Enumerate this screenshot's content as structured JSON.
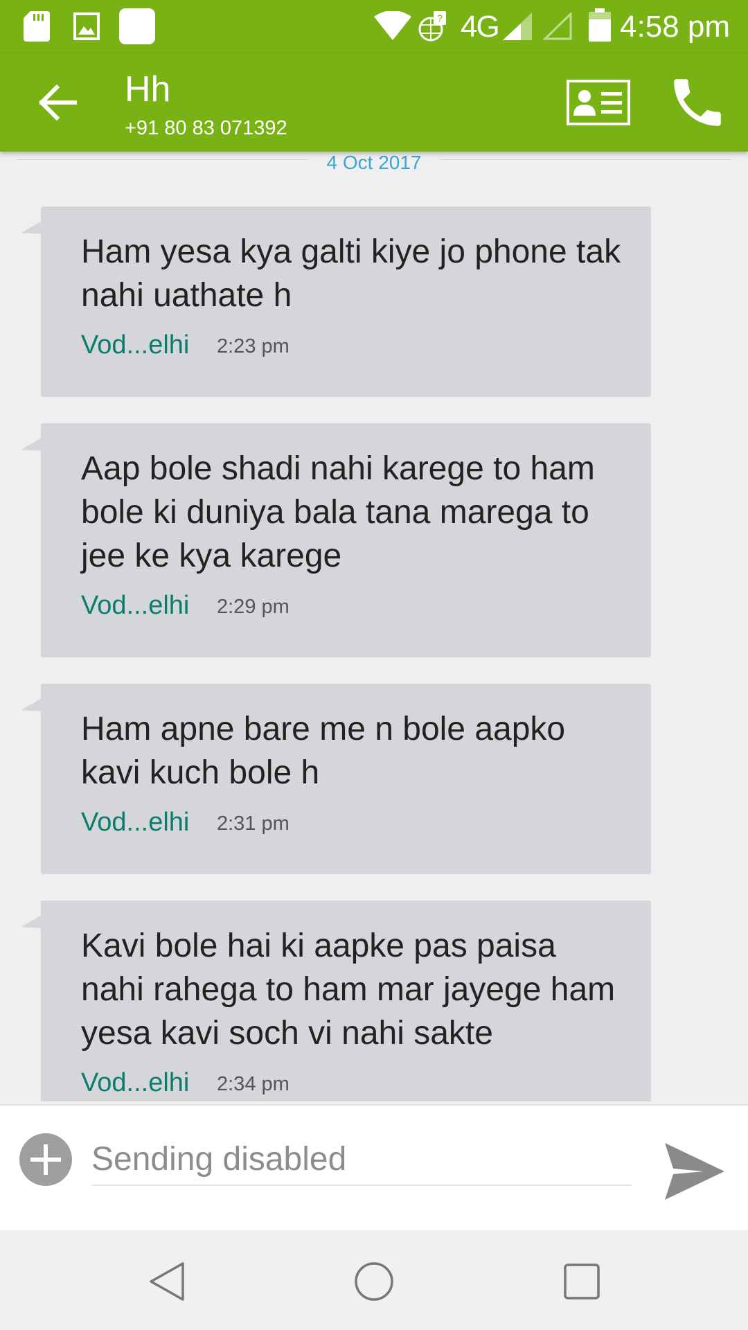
{
  "status_bar": {
    "time": "4:58 pm",
    "network": "4G",
    "icons": [
      "sd-card-icon",
      "gallery-icon",
      "notification-square-icon",
      "wifi-icon",
      "data-transfer-icon",
      "signal-icon",
      "signal-empty-icon",
      "battery-icon"
    ]
  },
  "app_bar": {
    "contact_name": "Hh",
    "contact_number": "+91 80 83 071392",
    "icons": [
      "back-arrow-icon",
      "contact-card-icon",
      "phone-icon"
    ]
  },
  "conversation": {
    "date": "4 Oct 2017",
    "messages": [
      {
        "text": "Ham yesa kya galti kiye jo phone tak nahi uathate h",
        "carrier": "Vod...elhi",
        "time": "2:23 pm"
      },
      {
        "text": "Aap bole shadi nahi karege to ham bole ki duniya bala tana marega to jee ke kya karege",
        "carrier": "Vod...elhi",
        "time": "2:29 pm"
      },
      {
        "text": "Ham apne bare me n bole aapko kavi kuch bole h",
        "carrier": "Vod...elhi",
        "time": "2:31 pm"
      },
      {
        "text": "Kavi bole hai ki aapke pas paisa nahi rahega to ham mar jayege ham yesa kavi soch vi nahi sakte",
        "carrier": "Vod...elhi",
        "time": "2:34 pm"
      }
    ]
  },
  "compose": {
    "placeholder": "Sending disabled",
    "icons": [
      "add-attachment-icon",
      "send-icon"
    ]
  },
  "nav_bar": {
    "icons": [
      "nav-back-icon",
      "nav-home-icon",
      "nav-recents-icon"
    ]
  },
  "colors": {
    "accent": "#78b215",
    "bubble": "#d4d6d9",
    "carrier_text": "#0b7d6e",
    "date_text": "#3ba6cf"
  }
}
